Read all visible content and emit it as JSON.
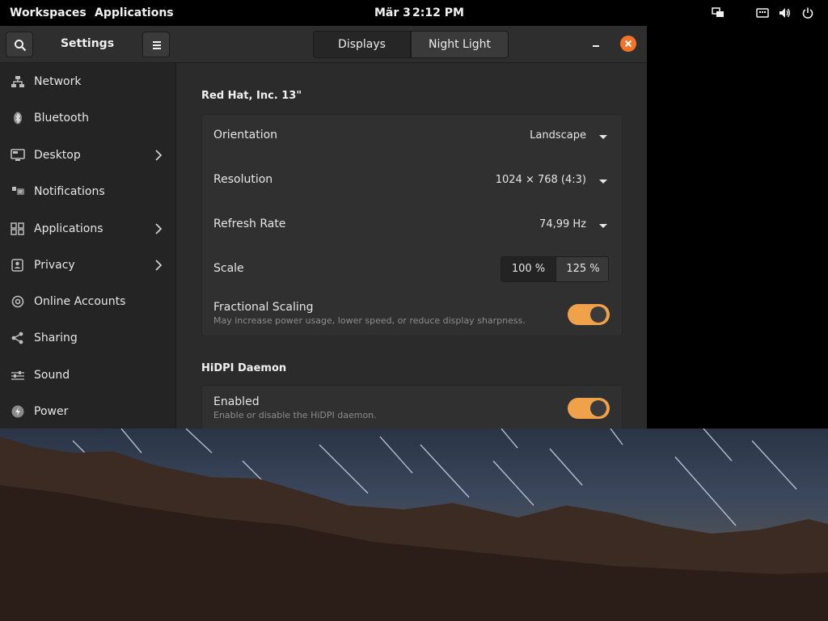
{
  "panel": {
    "workspaces": "Workspaces",
    "applications": "Applications",
    "date": "Mär 3",
    "time": "2:12 PM",
    "indicators": [
      "display-icon",
      "keyboard-icon",
      "volume-icon",
      "power-icon"
    ]
  },
  "sidebar": {
    "title": "Settings",
    "items": [
      {
        "label": "Network",
        "icon": "network-icon",
        "chevron": false
      },
      {
        "label": "Bluetooth",
        "icon": "bluetooth-icon",
        "chevron": false
      },
      {
        "label": "Desktop",
        "icon": "desktop-icon",
        "chevron": true
      },
      {
        "label": "Notifications",
        "icon": "notifications-icon",
        "chevron": false
      },
      {
        "label": "Applications",
        "icon": "applications-icon",
        "chevron": true
      },
      {
        "label": "Privacy",
        "icon": "privacy-icon",
        "chevron": true
      },
      {
        "label": "Online Accounts",
        "icon": "at-icon",
        "chevron": false
      },
      {
        "label": "Sharing",
        "icon": "share-icon",
        "chevron": false
      },
      {
        "label": "Sound",
        "icon": "sound-icon",
        "chevron": false
      },
      {
        "label": "Power",
        "icon": "power-icon",
        "chevron": false
      }
    ]
  },
  "header": {
    "tabs": [
      {
        "label": "Displays",
        "active": true
      },
      {
        "label": "Night Light",
        "active": false
      }
    ],
    "accent": "#f37329"
  },
  "display": {
    "section_title": "Red Hat, Inc. 13\"",
    "orientation_label": "Orientation",
    "orientation_value": "Landscape",
    "resolution_label": "Resolution",
    "resolution_value": "1024 × 768 (4:3)",
    "refresh_label": "Refresh Rate",
    "refresh_value": "74,99 Hz",
    "scale_label": "Scale",
    "scale_options": [
      "100 %",
      "125 %"
    ],
    "scale_selected": "100 %",
    "fractional_label": "Fractional Scaling",
    "fractional_desc": "May increase power usage, lower speed, or reduce display sharpness.",
    "fractional_enabled": true
  },
  "hidpi": {
    "section_title": "HiDPI Daemon",
    "enabled_label": "Enabled",
    "enabled_desc": "Enable or disable the HiDPI daemon.",
    "enabled": true
  },
  "colors": {
    "toggle_on": "#f0a24a",
    "close_button": "#f37329"
  }
}
